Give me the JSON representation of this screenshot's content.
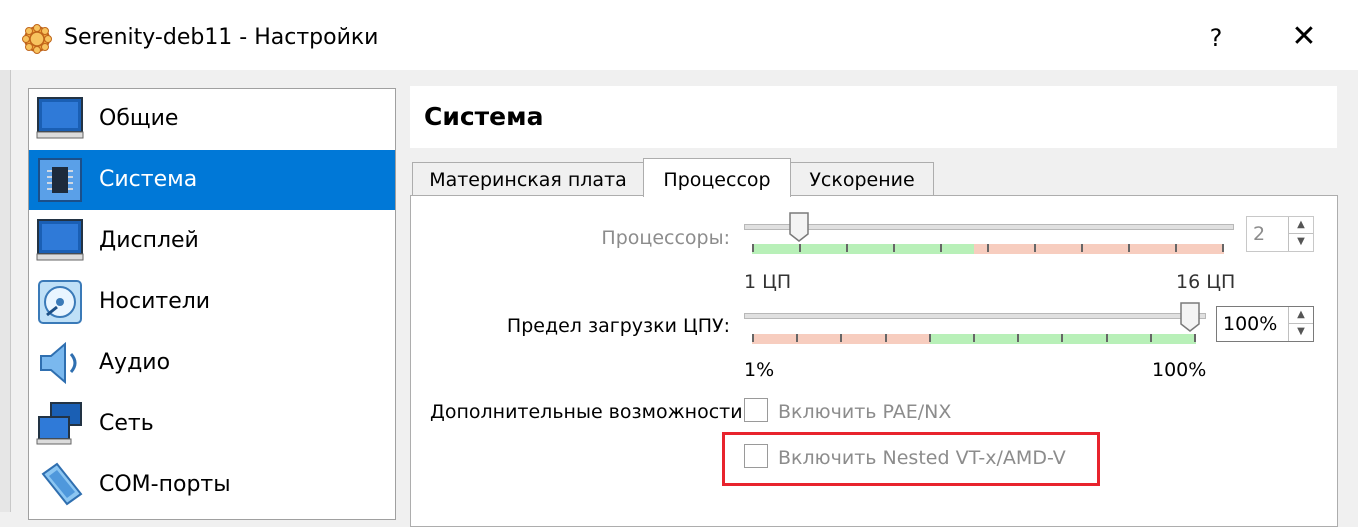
{
  "window": {
    "title": "Serenity-deb11 - Настройки",
    "help_label": "?",
    "close_label": "✕",
    "icon": "virtualbox-gear-icon"
  },
  "sidebar": {
    "items": [
      {
        "label": "Общие",
        "icon": "monitor-icon",
        "selected": false
      },
      {
        "label": "Система",
        "icon": "chip-icon",
        "selected": true
      },
      {
        "label": "Дисплей",
        "icon": "display-icon",
        "selected": false
      },
      {
        "label": "Носители",
        "icon": "disk-icon",
        "selected": false
      },
      {
        "label": "Аудио",
        "icon": "speaker-icon",
        "selected": false
      },
      {
        "label": "Сеть",
        "icon": "network-icon",
        "selected": false
      },
      {
        "label": "COM-порты",
        "icon": "serial-port-icon",
        "selected": false
      }
    ]
  },
  "page": {
    "title": "Система"
  },
  "tabs": [
    {
      "label": "Материнская плата",
      "active": false
    },
    {
      "label": "Процессор",
      "active": true
    },
    {
      "label": "Ускорение",
      "active": false
    }
  ],
  "processor": {
    "cpus": {
      "label": "Процессоры:",
      "value": "2",
      "min_label": "1 ЦП",
      "max_label": "16 ЦП",
      "min": 1,
      "max": 16,
      "current": 2,
      "enabled": false
    },
    "cpu_limit": {
      "label": "Предел загрузки ЦПУ:",
      "value": "100%",
      "min_label": "1%",
      "max_label": "100%",
      "min": 1,
      "max": 100,
      "current": 100
    },
    "extended": {
      "label": "Дополнительные возможности:",
      "pae_label": "Включить PAE/NX",
      "pae_checked": false,
      "nested_label": "Включить Nested VT-x/AMD-V",
      "nested_checked": false,
      "nested_highlighted": true
    }
  },
  "colors": {
    "selection": "#0078d7",
    "scale_green": "#b8f0b8",
    "scale_red": "#f7cdbf",
    "highlight_box": "#e8232d"
  }
}
